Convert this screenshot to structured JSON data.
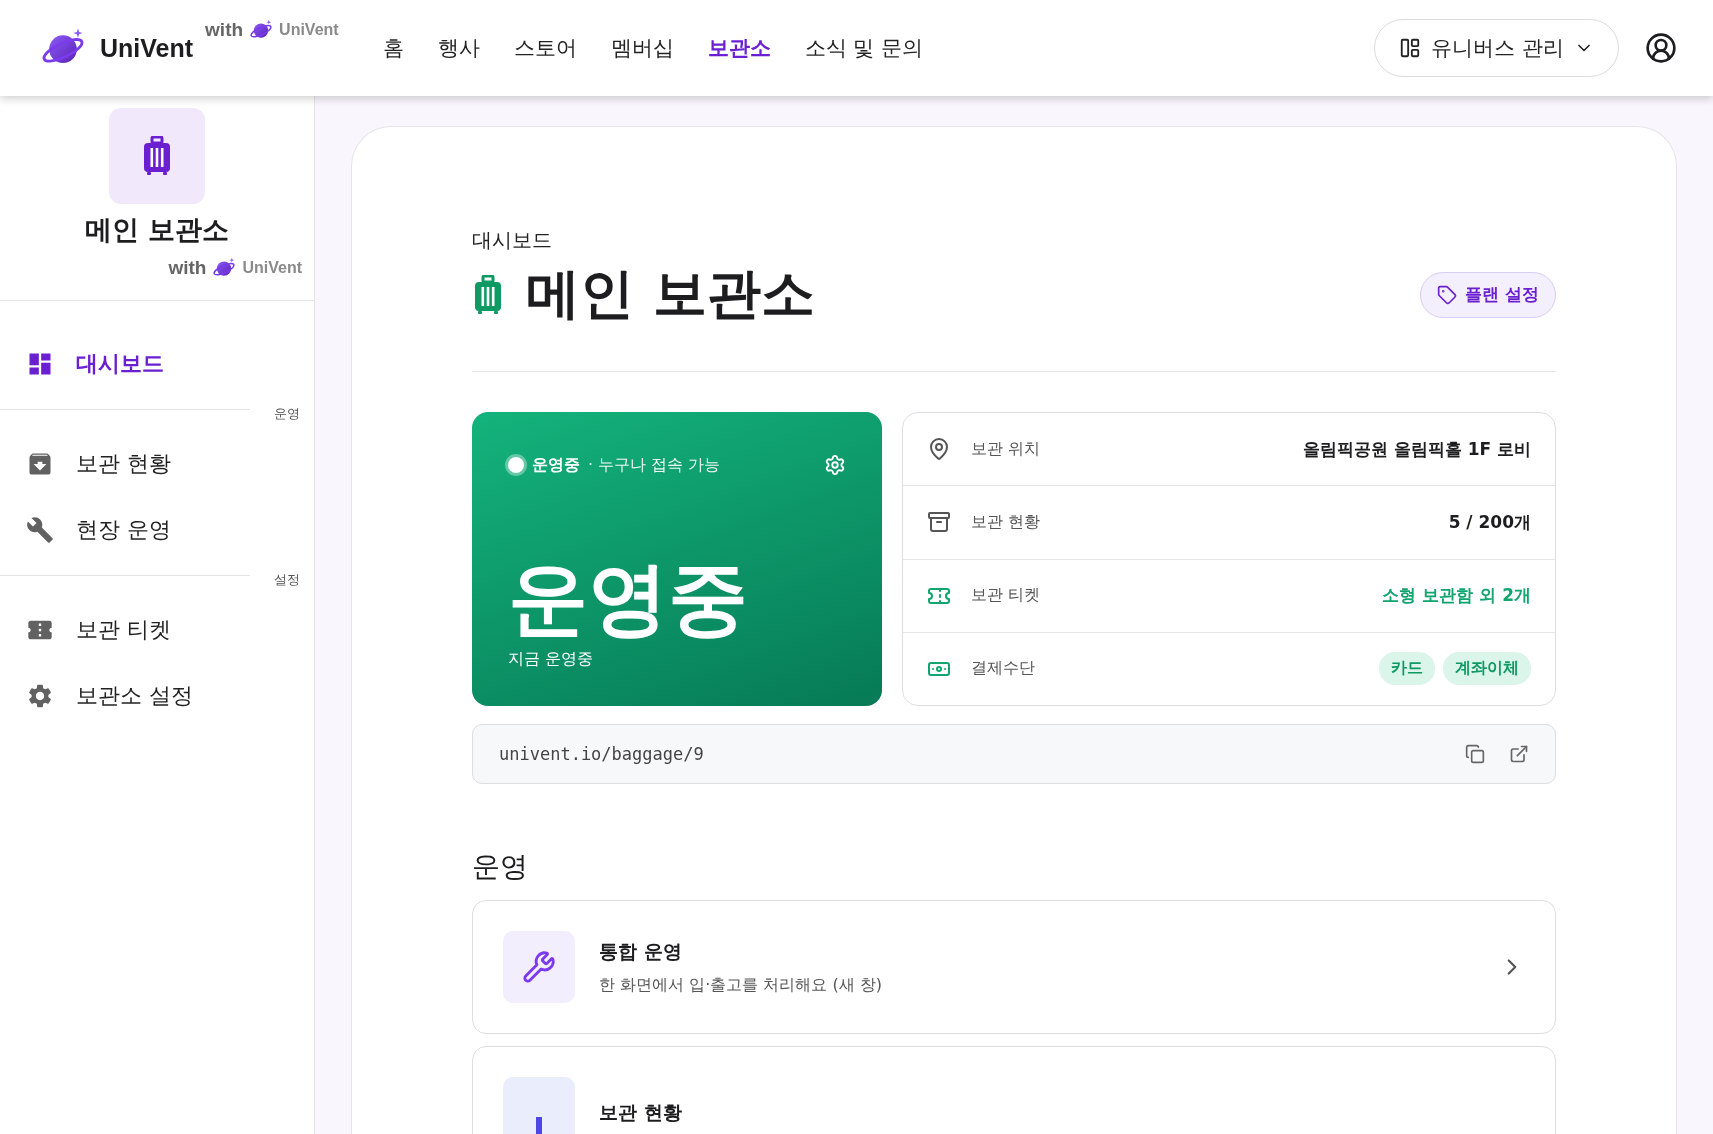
{
  "header": {
    "brand": "UniVent",
    "with_label": "with",
    "partner": "UniVent",
    "nav": [
      {
        "label": "홈",
        "selected": false
      },
      {
        "label": "행사",
        "selected": false
      },
      {
        "label": "스토어",
        "selected": false
      },
      {
        "label": "멤버십",
        "selected": false
      },
      {
        "label": "보관소",
        "selected": true
      },
      {
        "label": "소식 및 문의",
        "selected": false
      }
    ],
    "universe_button": "유니버스 관리"
  },
  "sidebar": {
    "title": "메인 보관소",
    "with_label": "with",
    "partner": "UniVent",
    "items": [
      {
        "kind": "item",
        "label": "대시보드",
        "selected": true
      },
      {
        "kind": "section",
        "label": "운영"
      },
      {
        "kind": "item",
        "label": "보관 현황",
        "selected": false
      },
      {
        "kind": "item",
        "label": "현장 운영",
        "selected": false
      },
      {
        "kind": "section",
        "label": "설정"
      },
      {
        "kind": "item",
        "label": "보관 티켓",
        "selected": false
      },
      {
        "kind": "item",
        "label": "보관소 설정",
        "selected": false
      }
    ]
  },
  "main": {
    "breadcrumb": "대시보드",
    "title": "메인 보관소",
    "plan_button": "플랜 설정",
    "status_card": {
      "status": "운영중",
      "access": "· 누구나 접속 가능",
      "headline": "운영중",
      "caption": "지금 운영중"
    },
    "info_rows": [
      {
        "label": "보관 위치",
        "kind": "text",
        "value": "올림픽공원 올림픽홀 1F 로비"
      },
      {
        "label": "보관 현황",
        "kind": "text",
        "value": "5 / 200개"
      },
      {
        "label": "보관 티켓",
        "kind": "accent",
        "value": "소형 보관함 외 2개"
      },
      {
        "label": "결제수단",
        "kind": "tags",
        "tags": [
          "카드",
          "계좌이체"
        ]
      }
    ],
    "url": "univent.io/baggage/9",
    "section_title": "운영",
    "menu_cards": [
      {
        "title": "통합 운영",
        "description": "한 화면에서 입·출고를 처리해요 (새 창)"
      },
      {
        "title": "보관 현황"
      }
    ]
  }
}
